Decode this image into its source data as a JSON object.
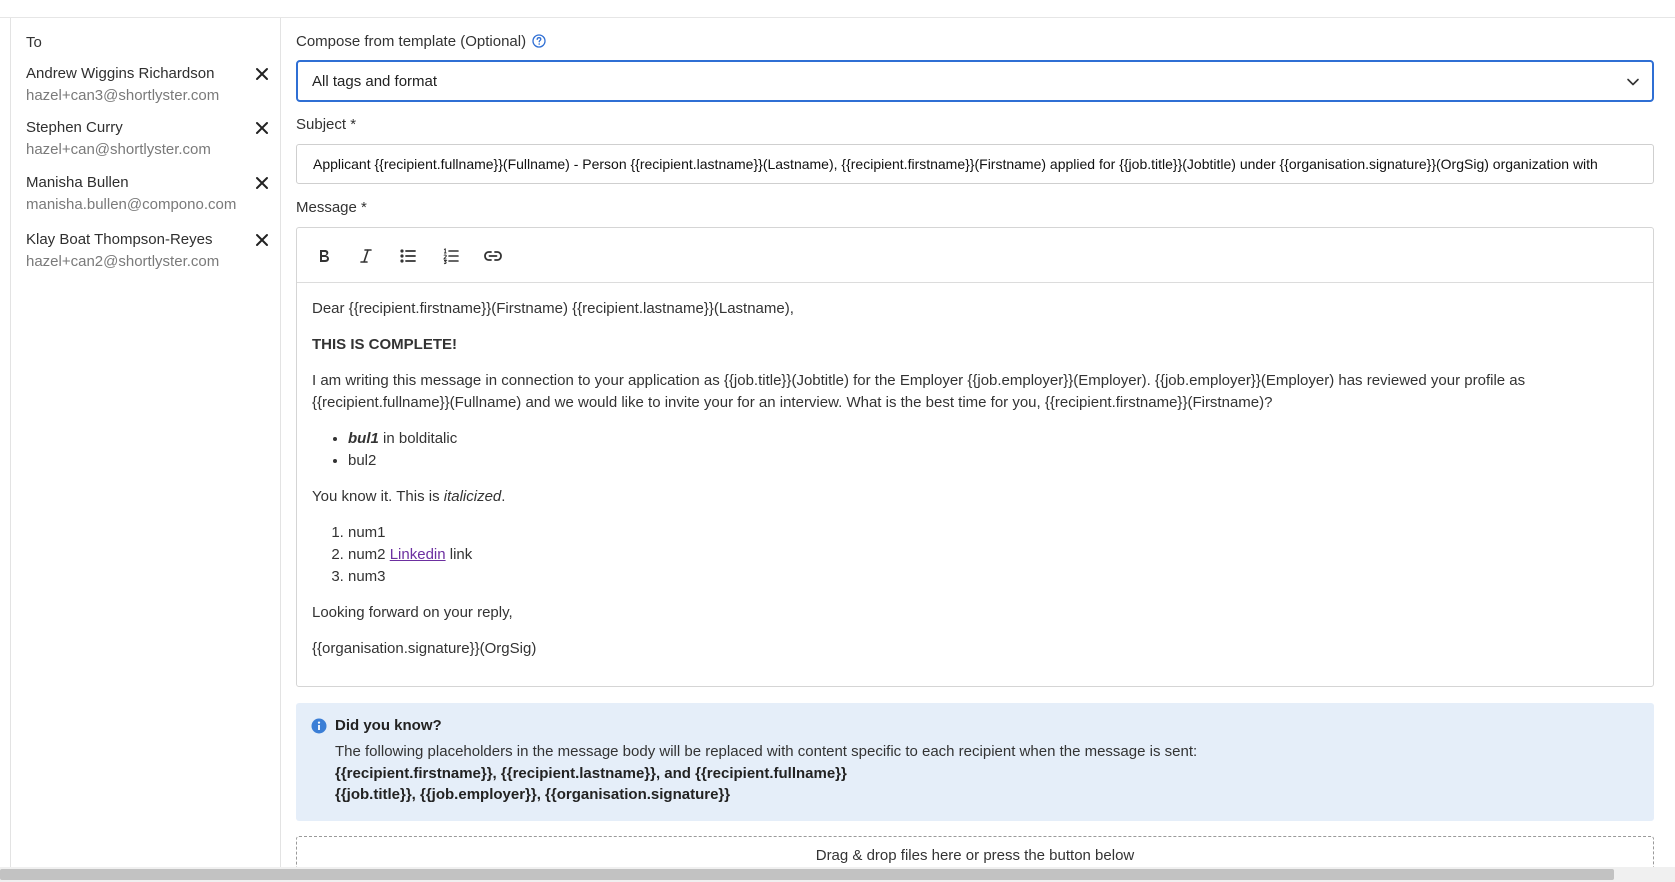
{
  "recipients_panel": {
    "to_label": "To",
    "recipients": [
      {
        "name": "Andrew Wiggins Richardson",
        "email": "hazel+can3@shortlyster.com"
      },
      {
        "name": "Stephen Curry",
        "email": "hazel+can@shortlyster.com"
      },
      {
        "name": "Manisha Bullen",
        "email": "manisha.bullen@compono.com"
      },
      {
        "name": "Klay Boat Thompson-Reyes",
        "email": "hazel+can2@shortlyster.com"
      }
    ]
  },
  "template": {
    "label": "Compose from template (Optional)",
    "selected": "All tags and format"
  },
  "subject": {
    "label": "Subject *",
    "value": "Applicant {{recipient.fullname}}(Fullname) - Person {{recipient.lastname}}(Lastname), {{recipient.firstname}}(Firstname) applied for {{job.title}}(Jobtitle) under {{organisation.signature}}(OrgSig) organization with"
  },
  "message": {
    "label": "Message *",
    "toolbar": [
      "bold-icon",
      "italic-icon",
      "bullet-list-icon",
      "numbered-list-icon",
      "link-icon"
    ],
    "greeting": "Dear {{recipient.firstname}}(Firstname) {{recipient.lastname}}(Lastname),",
    "headline": "THIS IS COMPLETE!",
    "paragraph": "I am writing this message in connection to your application as {{job.title}}(Jobtitle) for the Employer {{job.employer}}(Employer). {{job.employer}}(Employer) has reviewed your profile as {{recipient.fullname}}(Fullname) and we would like to invite your for an interview. What is the best time for you, {{recipient.firstname}}(Firstname)?",
    "bullet1_bolditalic": "bul1",
    "bullet1_rest": " in bolditalic",
    "bullet2": "bul2",
    "know_prefix": "You know it. This is ",
    "know_italic": "italicized",
    "know_suffix": ".",
    "num1": "num1",
    "num2_prefix": "num2 ",
    "num2_link": "Linkedin",
    "num2_suffix": " link",
    "num3": "num3",
    "closing": "Looking forward on your reply,",
    "signature": "{{organisation.signature}}(OrgSig)"
  },
  "info": {
    "title": "Did you know?",
    "text": "The following placeholders in the message body will be replaced with content specific to each recipient when the message is sent:",
    "placeholders_line1": "{{recipient.firstname}}, {{recipient.lastname}}, and {{recipient.fullname}}",
    "placeholders_line2": "{{job.title}}, {{job.employer}}, {{organisation.signature}}"
  },
  "dropzone": {
    "text": "Drag & drop files here or press the button below"
  },
  "colors": {
    "accent": "#2f6fd4",
    "info_bg": "#e5eef9",
    "link": "#6c2fa0"
  }
}
